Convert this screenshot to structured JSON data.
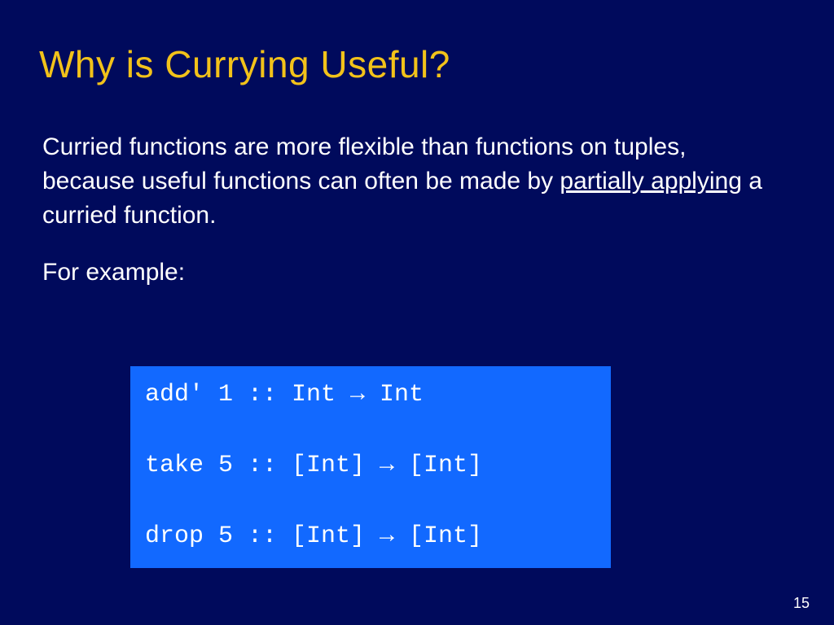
{
  "slide": {
    "title": "Why is Currying Useful?",
    "paragraph_pre": "Curried functions are more flexible than functions on tuples, because useful functions can often be made by ",
    "paragraph_underlined": "partially applying",
    "paragraph_post": " a curried function.",
    "example_label": "For example:",
    "code_line1": "add' 1 :: Int → Int",
    "code_line2": "take 5 :: [Int] → [Int]",
    "code_line3": "drop 5 :: [Int] → [Int]",
    "page_number": "15"
  }
}
